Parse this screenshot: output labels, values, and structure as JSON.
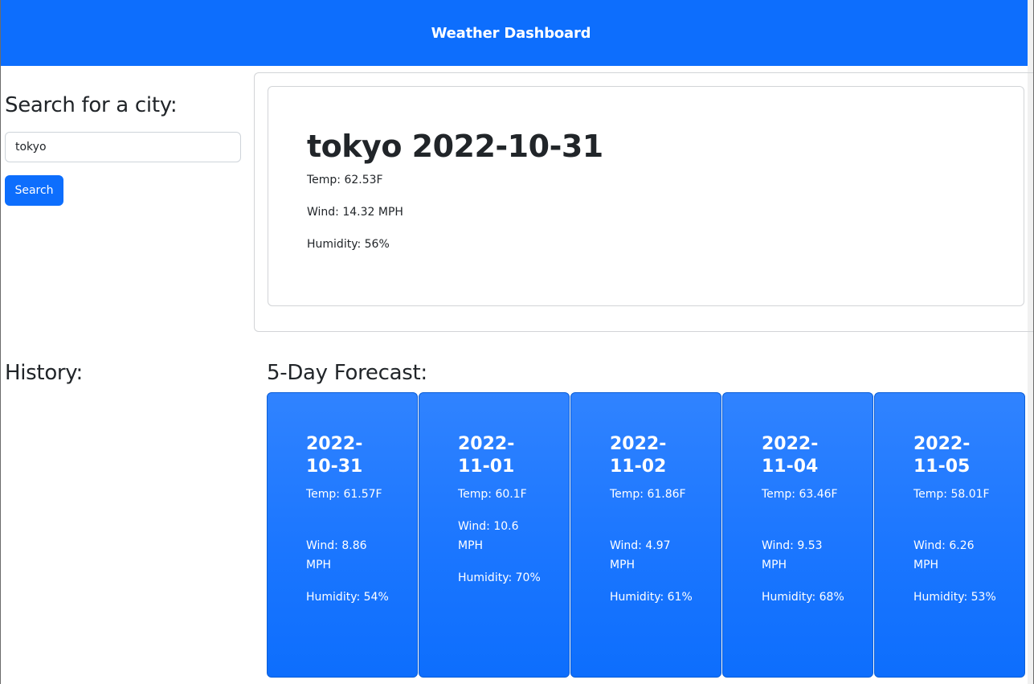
{
  "navbar": {
    "title": "Weather Dashboard"
  },
  "search": {
    "heading": "Search for a city:",
    "input_value": "tokyo",
    "button_label": "Search"
  },
  "current": {
    "title": "tokyo 2022-10-31",
    "temp": "Temp: 62.53F",
    "wind": "Wind: 14.32 MPH",
    "humidity": "Humidity: 56%"
  },
  "history": {
    "heading": "History:"
  },
  "forecast": {
    "heading": "5-Day Forecast:",
    "days": [
      {
        "date": "2022-10-31",
        "temp": "Temp: 61.57F",
        "wind": "Wind: 8.86 MPH",
        "humidity": "Humidity: 54%"
      },
      {
        "date": "2022-11-01",
        "temp": "Temp: 60.1F",
        "wind": "Wind: 10.6 MPH",
        "humidity": "Humidity: 70%"
      },
      {
        "date": "2022-11-02",
        "temp": "Temp: 61.86F",
        "wind": "Wind: 4.97 MPH",
        "humidity": "Humidity: 61%"
      },
      {
        "date": "2022-11-04",
        "temp": "Temp: 63.46F",
        "wind": "Wind: 9.53 MPH",
        "humidity": "Humidity: 68%"
      },
      {
        "date": "2022-11-05",
        "temp": "Temp: 58.01F",
        "wind": "Wind: 6.26 MPH",
        "humidity": "Humidity: 53%"
      }
    ]
  },
  "colors": {
    "primary": "#0d6efd",
    "card_top": "#3083ff",
    "border": "#d2d4d7",
    "text": "#212529"
  }
}
